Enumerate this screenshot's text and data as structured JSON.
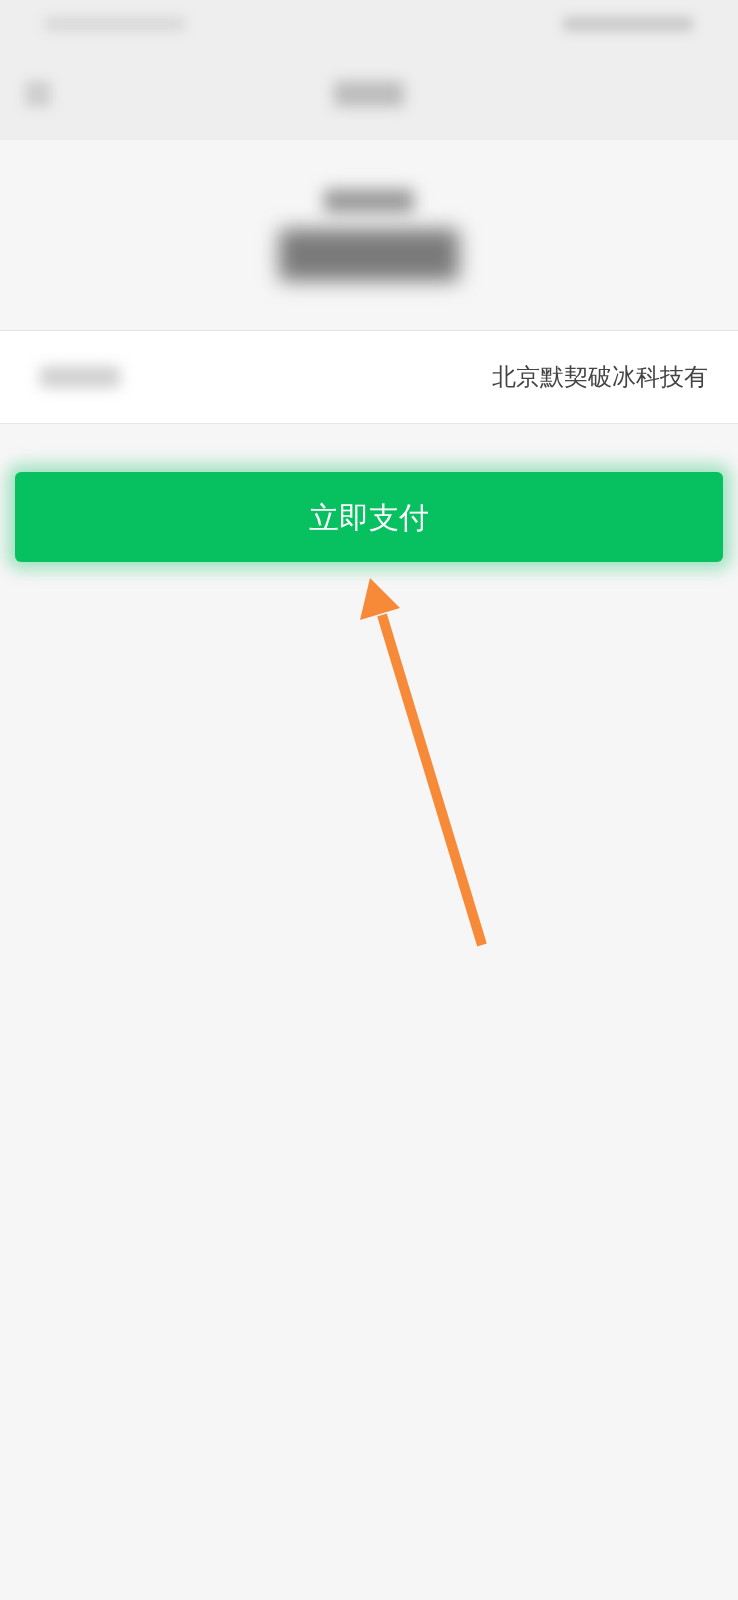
{
  "merchant_row": {
    "value": "北京默契破冰科技有"
  },
  "pay_button": {
    "label": "立即支付"
  }
}
